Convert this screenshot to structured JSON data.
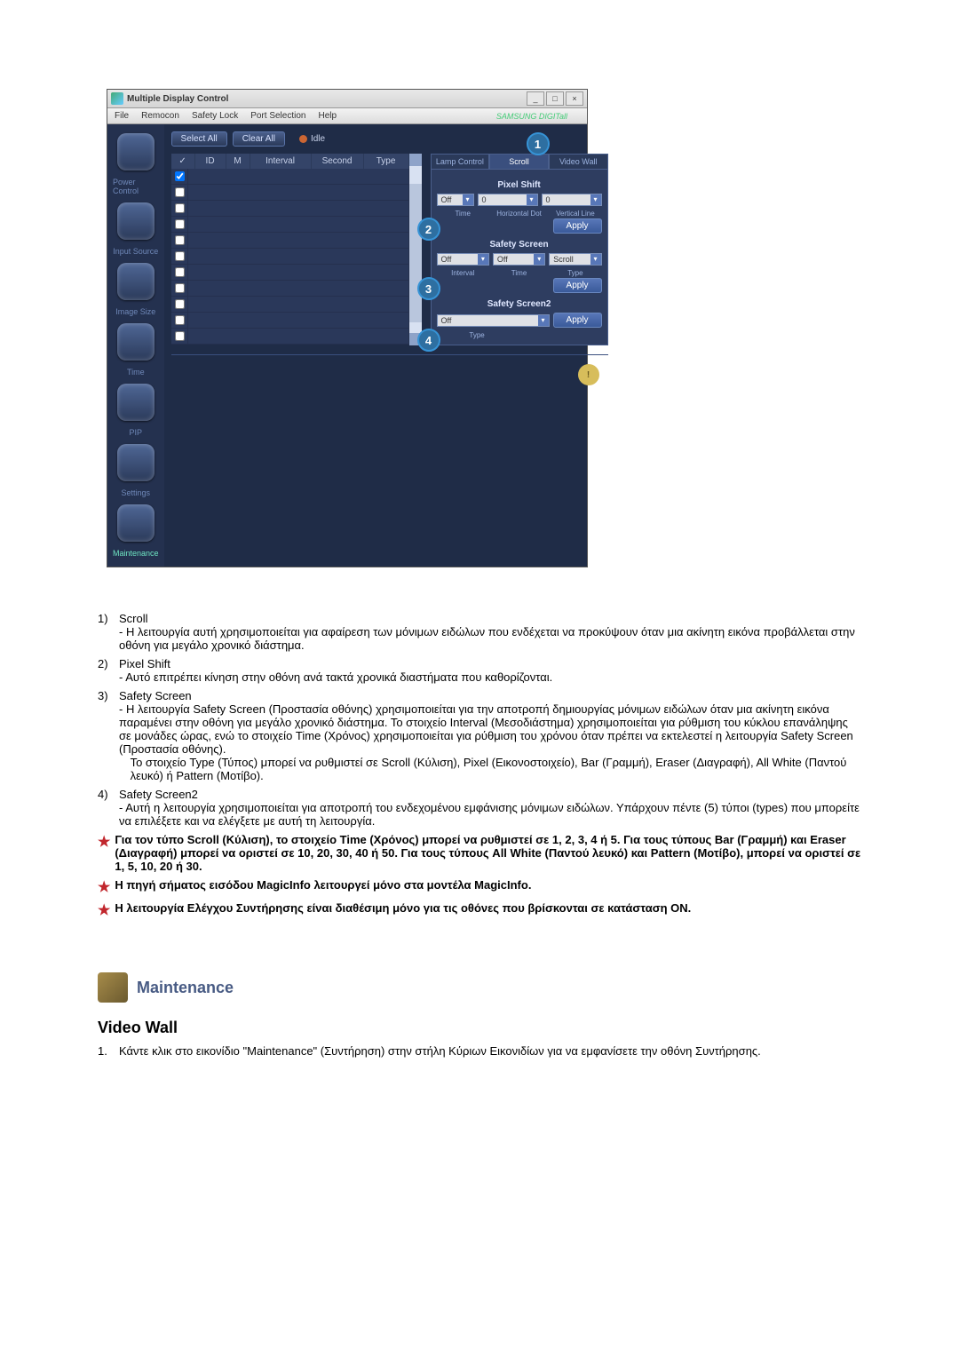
{
  "app": {
    "title": "Multiple Display Control",
    "menu": [
      "File",
      "Remocon",
      "Safety Lock",
      "Port Selection",
      "Help"
    ],
    "brand": "SAMSUNG DIGITall",
    "sidebar": [
      {
        "icon": "power-icon",
        "label": "Power Control"
      },
      {
        "icon": "signal-icon",
        "label": "Input Source"
      },
      {
        "icon": "screen-icon",
        "label": "Image Size"
      },
      {
        "icon": "clock-icon",
        "label": "Time"
      },
      {
        "icon": "pip-icon",
        "label": "PIP"
      },
      {
        "icon": "settings-icon",
        "label": "Settings"
      },
      {
        "icon": "maintenance-icon",
        "label": "Maintenance",
        "active": true
      }
    ],
    "top_buttons": {
      "select_all": "Select All",
      "clear_all": "Clear All"
    },
    "status_label": "Idle",
    "table_headers": {
      "chk": "✓",
      "id": "ID",
      "m": "M",
      "interval": "Interval",
      "second": "Second",
      "type": "Type"
    },
    "table_row_count": 11
  },
  "right_panel": {
    "tabs": {
      "lamp": "Lamp Control",
      "scroll": "Scroll",
      "video": "Video Wall"
    },
    "pixel_shift": {
      "title": "Pixel Shift",
      "time": "Off",
      "hdot": "0",
      "vline": "0",
      "labels": {
        "time": "Time",
        "hdot": "Horizontal Dot",
        "vline": "Vertical Line"
      }
    },
    "safety_screen": {
      "title": "Safety Screen",
      "interval": "Off",
      "time": "Off",
      "type": "Scroll",
      "labels": {
        "interval": "Interval",
        "time": "Time",
        "type": "Type"
      }
    },
    "safety_screen2": {
      "title": "Safety Screen2",
      "type": "Off",
      "labels": {
        "type": "Type"
      }
    },
    "apply": "Apply"
  },
  "circles": {
    "c1": "1",
    "c2": "2",
    "c3": "3",
    "c4": "4"
  },
  "explain": {
    "items": [
      {
        "num": "1)",
        "title": "Scroll",
        "text": "- Η λειτουργία αυτή χρησιμοποιείται για αφαίρεση των μόνιμων ειδώλων που ενδέχεται να προκύψουν όταν μια ακίνητη εικόνα προβάλλεται στην οθόνη για μεγάλο χρονικό διάστημα."
      },
      {
        "num": "2)",
        "title": "Pixel Shift",
        "text": "- Αυτό επιτρέπει κίνηση στην οθόνη ανά τακτά χρονικά διαστήματα που καθορίζονται."
      },
      {
        "num": "3)",
        "title": "Safety Screen",
        "text": "- Η λειτουργία Safety Screen (Προστασία οθόνης) χρησιμοποιείται για την αποτροπή δημιουργίας μόνιμων ειδώλων όταν μια ακίνητη εικόνα παραμένει στην οθόνη για μεγάλο χρονικό διάστημα.  Το στοιχείο Interval (Μεσοδιάστημα) χρησιμοποιείται για ρύθμιση του κύκλου επανάληψης σε μονάδες ώρας, ενώ το στοιχείο Time (Χρόνος) χρησιμοποιείται για ρύθμιση του χρόνου όταν πρέπει να εκτελεστεί η λειτουργία Safety Screen (Προστασία οθόνης).",
        "text2": "Το στοιχείο Type (Τύπος) μπορεί να ρυθμιστεί σε Scroll (Κύλιση), Pixel (Εικονοστοιχείο), Bar (Γραμμή), Eraser (Διαγραφή), All White (Παντού λευκό) ή Pattern (Μοτίβο)."
      },
      {
        "num": "4)",
        "title": "Safety Screen2",
        "text": "- Αυτή η λειτουργία χρησιμοποιείται για αποτροπή του ενδεχομένου εμφάνισης μόνιμων ειδώλων. Υπάρχουν πέντε (5) τύποι (types) που μπορείτε να επιλέξετε και να ελέγξετε με αυτή τη λειτουργία."
      }
    ],
    "notes": [
      "Για τον τύπο Scroll (Κύλιση), το στοιχείο Time (Χρόνος) μπορεί να ρυθμιστεί σε 1, 2, 3, 4 ή 5. Για τους τύπους Bar (Γραμμή) και Eraser (Διαγραφή) μπορεί να οριστεί σε 10, 20, 30, 40 ή 50. Για τους τύπους All White (Παντού λευκό) και Pattern (Μοτίβο), μπορεί να οριστεί σε 1, 5, 10, 20 ή 30.",
      "Η πηγή σήματος εισόδου MagicInfo λειτουργεί μόνο στα μοντέλα MagicInfo.",
      "Η λειτουργία Ελέγχου Συντήρησης είναι διαθέσιμη μόνο για τις οθόνες που βρίσκονται σε κατάσταση ON."
    ]
  },
  "section": {
    "maintenance": "Maintenance",
    "videowall": "Video Wall",
    "vw_item1_num": "1.",
    "vw_item1": "Κάντε κλικ στο εικονίδιο \"Maintenance\" (Συντήρηση) στην στήλη Κύριων Εικονιδίων για να εμφανίσετε την οθόνη Συντήρησης."
  }
}
